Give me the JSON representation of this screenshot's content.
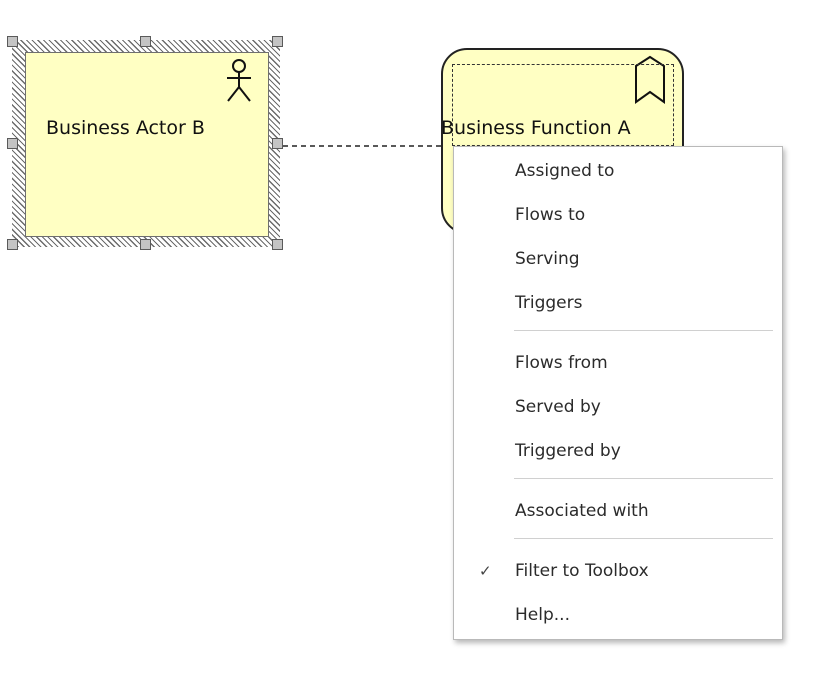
{
  "diagram": {
    "elements": {
      "business_actor": {
        "label": "Business Actor B",
        "icon": "actor-icon"
      },
      "business_function": {
        "label": "Business Function A",
        "icon": "function-bookmark-icon"
      }
    },
    "connector": {
      "style": "dashed"
    }
  },
  "context_menu": {
    "groups": [
      [
        "Assigned to",
        "Flows to",
        "Serving",
        "Triggers"
      ],
      [
        "Flows from",
        "Served by",
        "Triggered by"
      ],
      [
        "Associated with"
      ],
      [
        "Filter to Toolbox",
        "Help..."
      ]
    ],
    "checked_item": "Filter to Toolbox",
    "check_glyph": "✓"
  },
  "colors": {
    "element_fill": "#ffffc3",
    "menu_background": "#ffffff"
  }
}
